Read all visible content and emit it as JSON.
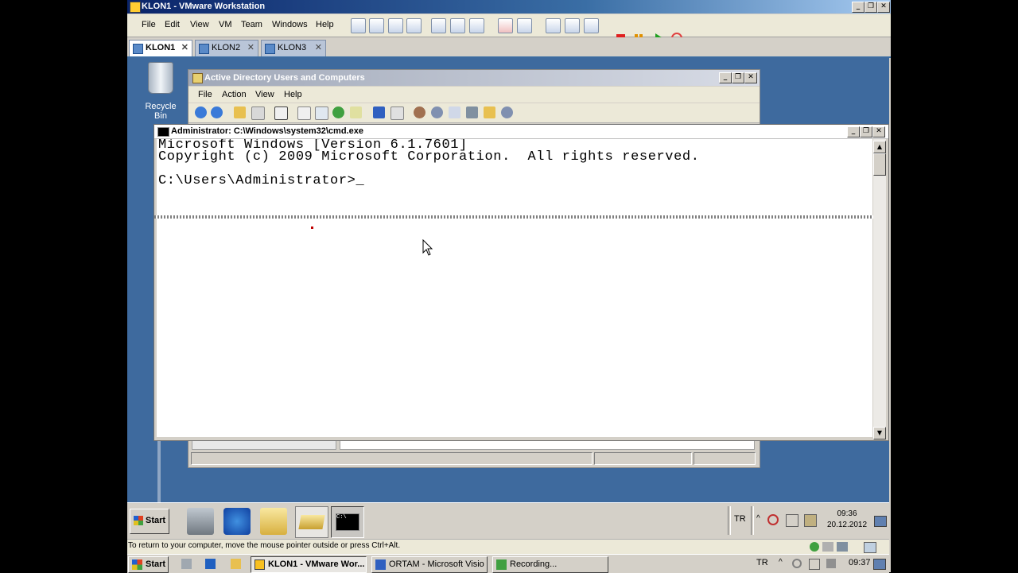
{
  "vmware": {
    "title": "KLON1 - VMware Workstation",
    "menu": [
      "File",
      "Edit",
      "View",
      "VM",
      "Team",
      "Windows",
      "Help"
    ],
    "tabs": [
      {
        "label": "KLON1",
        "active": true
      },
      {
        "label": "KLON2",
        "active": false
      },
      {
        "label": "KLON3",
        "active": false
      }
    ],
    "status_hint": "To return to your computer, move the mouse pointer outside or press Ctrl+Alt."
  },
  "desktop": {
    "recycle_bin_label": "Recycle Bin"
  },
  "ad_window": {
    "title": "Active Directory Users and Computers",
    "menu": [
      "File",
      "Action",
      "View",
      "Help"
    ]
  },
  "cmd_window": {
    "title": "Administrator: C:\\Windows\\system32\\cmd.exe",
    "lines": [
      "Microsoft Windows [Version 6.1.7601]",
      "Copyright (c) 2009 Microsoft Corporation.  All rights reserved.",
      "",
      "C:\\Users\\Administrator>_"
    ]
  },
  "guest_taskbar": {
    "start_label": "Start",
    "lang": "TR",
    "time": "09:36",
    "date": "20.12.2012"
  },
  "host_taskbar": {
    "start_label": "Start",
    "buttons": [
      {
        "label": "KLON1 - VMware Wor...",
        "pressed": true
      },
      {
        "label": "ORTAM - Microsoft Visio",
        "pressed": false
      },
      {
        "label": "Recording...",
        "pressed": false
      }
    ],
    "lang": "TR",
    "time": "09:37"
  },
  "colors": {
    "vmware_title": "#0a246a",
    "guest_desktop": "#3e6a9e",
    "host_background": "#000000"
  }
}
